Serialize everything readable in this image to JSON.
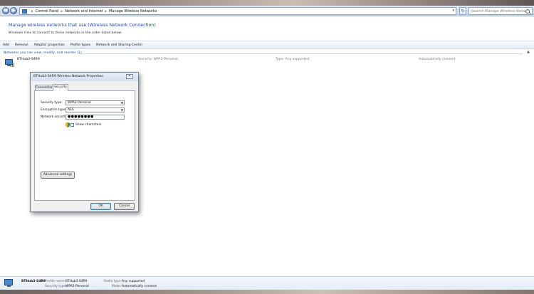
{
  "address_bar": {
    "breadcrumbs": [
      "Control Panel",
      "Network and Internet",
      "Manage Wireless Networks"
    ],
    "search_placeholder": "Search Manage Wireless Networks"
  },
  "header": {
    "title": "Manage wireless networks that use (Wireless Network Connection)",
    "description": "Windows tries to connect to these networks in the order listed below."
  },
  "toolbar": {
    "items": [
      "Add",
      "Remove",
      "Adapter properties",
      "Profile types",
      "Network and Sharing Center"
    ]
  },
  "group": {
    "header": "Networks you can view, modify, and reorder (1)"
  },
  "network": {
    "name": "BTHub3-S4R9",
    "security": "Security: WPA2-Personal",
    "type": "Type: Any supported",
    "mode": "Automatically connect"
  },
  "dialog": {
    "title": "BTHub3-S4R9 Wireless Network Properties",
    "close_label": "✕",
    "tabs": [
      "Connection",
      "Security"
    ],
    "security_type_label": "Security type:",
    "security_type_value": "WPA2-Personal",
    "encryption_type_label": "Encryption type:",
    "encryption_type_value": "AES",
    "network_key_label": "Network security key",
    "network_key_value": "●●●●●●●●",
    "show_characters_label": "Show characters",
    "advanced_label": "Advanced settings",
    "ok_label": "OK",
    "cancel_label": "Cancel"
  },
  "details": {
    "name": "BTHub3-S4R9",
    "profile_name_key": "Profile name:",
    "profile_name_value": "BTHub3-S4R9",
    "security_type_key": "Security type:",
    "security_type_value": "WPA2-Personal",
    "radio_type_key": "Radio type:",
    "radio_type_value": "Any supported",
    "mode_key": "Mode:",
    "mode_value": "Automatically connect"
  }
}
